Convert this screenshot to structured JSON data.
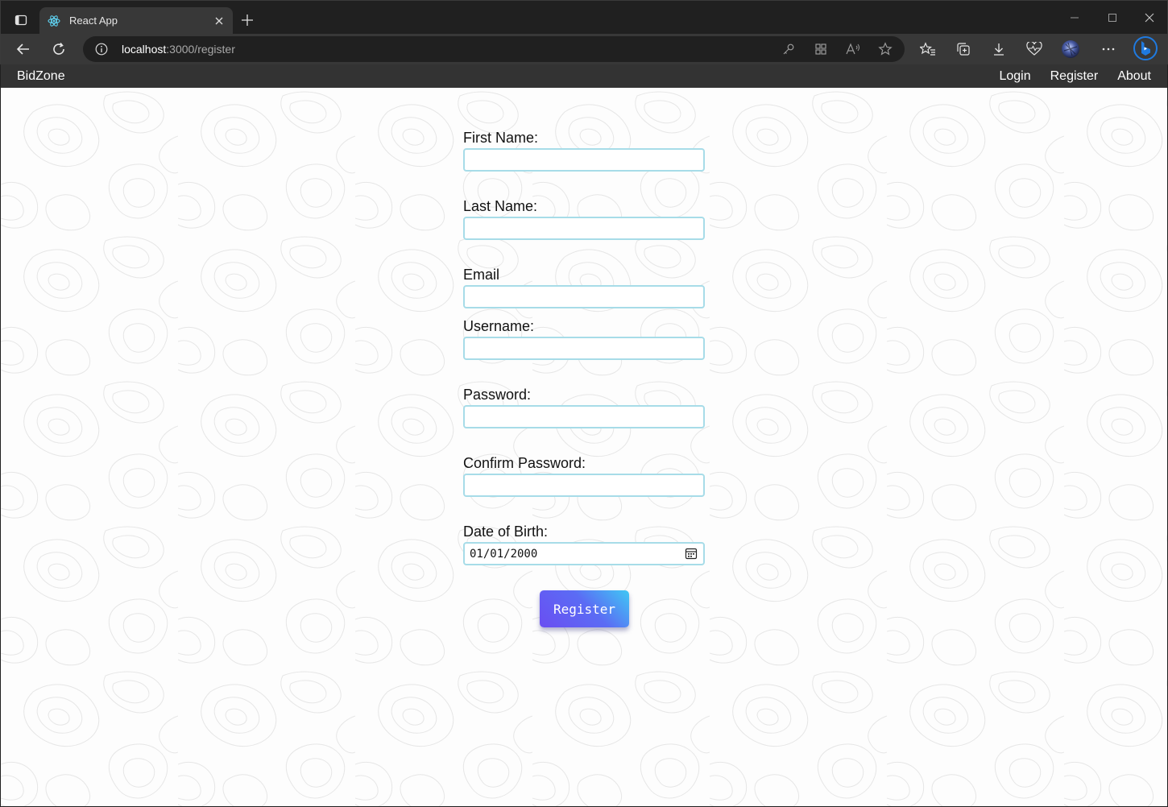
{
  "browser": {
    "tab_title": "React App",
    "url_host": "localhost",
    "url_path": ":3000/register"
  },
  "icons": {
    "tab_actions": "tab-actions-icon",
    "favicon": "react-icon",
    "close_tab": "close-icon",
    "new_tab": "plus-icon",
    "minimize": "minimize-icon",
    "maximize": "maximize-icon",
    "close_window": "close-icon",
    "back": "back-arrow-icon",
    "refresh": "refresh-icon",
    "site_info": "info-icon",
    "password_key": "key-icon",
    "apps": "apps-icon",
    "read_aloud": "read-aloud-icon",
    "favorite": "star-icon",
    "favorites": "favorites-icon",
    "collections": "collections-icon",
    "downloads": "download-icon",
    "performance": "heartbeat-icon",
    "profile": "avatar",
    "more": "more-icon",
    "copilot": "bing-icon",
    "calendar": "calendar-icon"
  },
  "colors": {
    "navbar_bg": "#333333",
    "input_border": "#a7dce8",
    "button_gradient_start": "#40c8f4",
    "button_gradient_end": "#6a4ef2"
  },
  "navbar": {
    "brand": "BidZone",
    "links": [
      "Login",
      "Register",
      "About"
    ]
  },
  "form": {
    "first_name_label": "First Name:",
    "last_name_label": "Last Name:",
    "email_label": "Email",
    "username_label": "Username:",
    "password_label": "Password:",
    "confirm_password_label": "Confirm Password:",
    "dob_label": "Date of Birth:",
    "dob_value": "01/01/2000",
    "first_name_value": "",
    "last_name_value": "",
    "email_value": "",
    "username_value": "",
    "password_value": "",
    "confirm_password_value": "",
    "submit_label": "Register"
  }
}
